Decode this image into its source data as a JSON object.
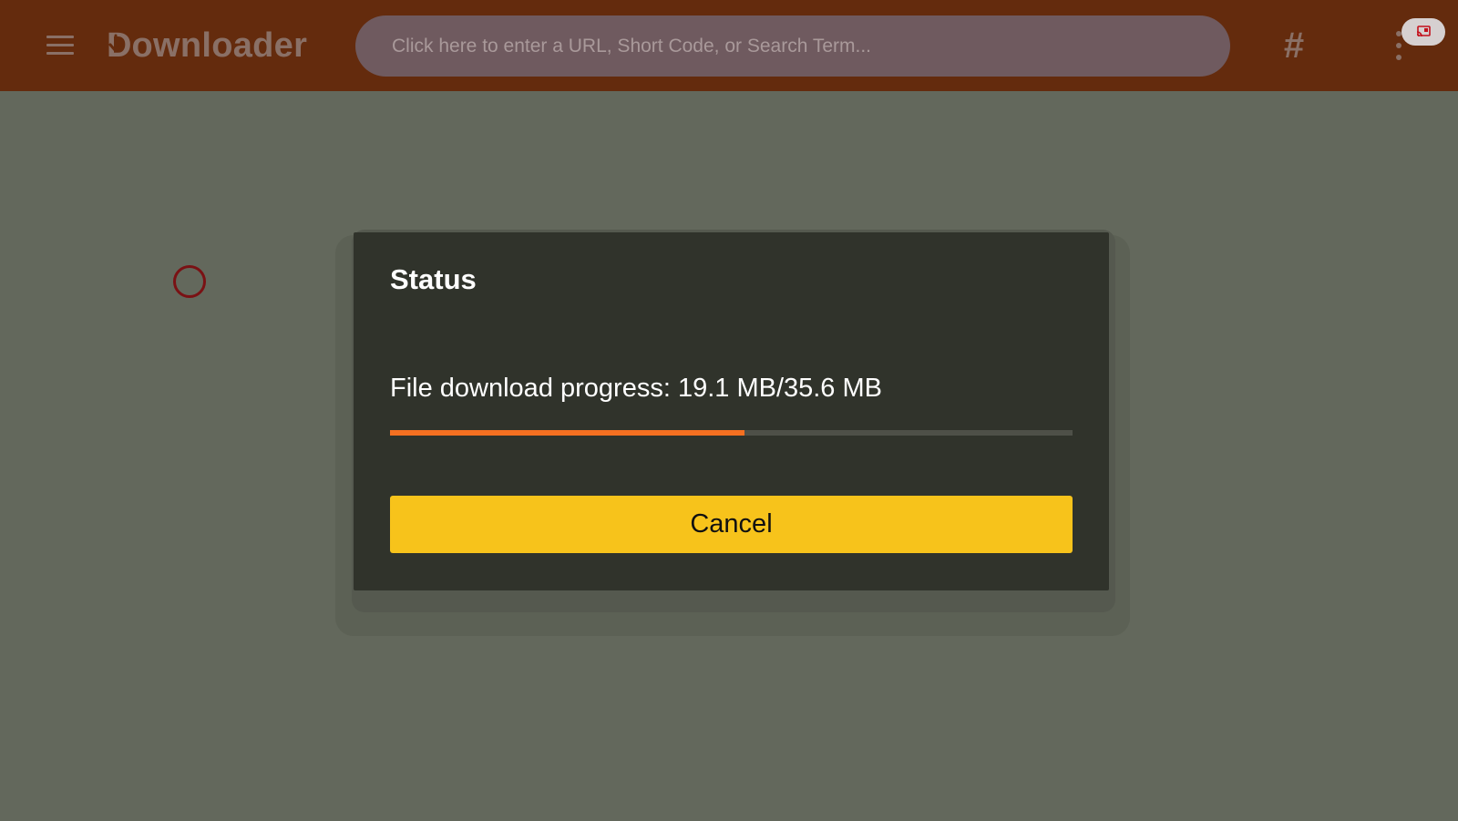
{
  "app": {
    "name": "Downloader",
    "logo_first_letter": "D",
    "logo_rest": "ownloader"
  },
  "toolbar": {
    "search_placeholder": "Click here to enter a URL, Short Code, or Search Term...",
    "hash_label": "#",
    "icons": {
      "menu": "menu-icon",
      "hash": "hash-icon",
      "more": "more-vertical-icon",
      "cast": "cast-icon"
    }
  },
  "dialog": {
    "title": "Status",
    "progress_label": "File download progress: 19.1 MB/35.6 MB",
    "downloaded_mb": 19.1,
    "total_mb": 35.6,
    "progress_fraction": 0.52,
    "cancel_label": "Cancel"
  },
  "colors": {
    "appbar": "#642b0d",
    "background": "#63685c",
    "dialog": "#30332b",
    "progress_fill": "#f47021",
    "progress_track": "#4e5048",
    "button": "#f7c31b",
    "focus_ring": "#7a1114"
  }
}
